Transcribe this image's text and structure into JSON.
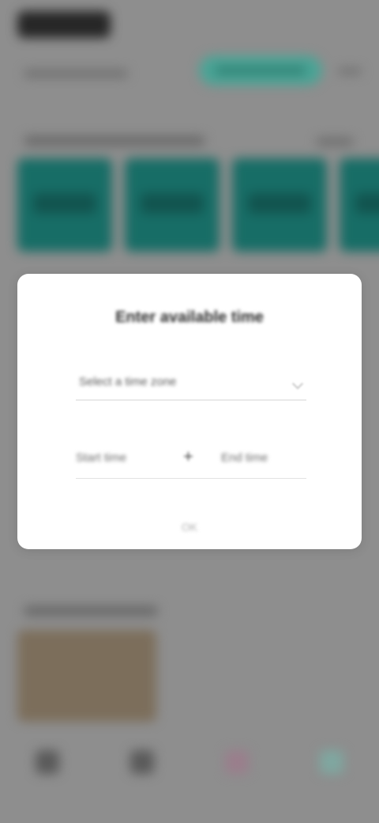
{
  "background": {
    "app_logo": "",
    "subtitle": "",
    "pill_button_label": "",
    "section_title": "",
    "see_all": "",
    "lower_section_title": ""
  },
  "dialog": {
    "title": "Enter available time",
    "input_value": "Select a time zone",
    "time_from": "Start time",
    "time_separator": "+",
    "time_to": "End time",
    "confirm_label": "OK"
  },
  "colors": {
    "accent": "#176d66",
    "pill": "#4aa496",
    "overlay": "#8e8e8e"
  },
  "icons": {
    "nav_1": "home-icon",
    "nav_2": "chat-icon",
    "nav_3": "heart-icon",
    "nav_4": "profile-icon",
    "dropdown": "chevron-down-icon"
  }
}
